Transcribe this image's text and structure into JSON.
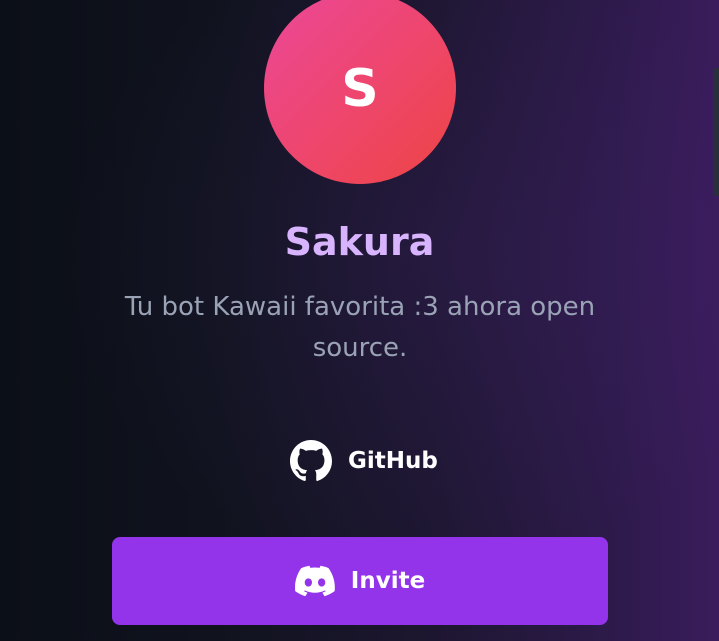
{
  "profile": {
    "avatar_letter": "S",
    "name": "Sakura",
    "tagline": "Tu bot Kawaii favorita :3 ahora open source."
  },
  "links": {
    "github_label": "GitHub",
    "github_icon": "github-icon",
    "invite_label": "Invite",
    "invite_icon": "discord-icon"
  },
  "colors": {
    "name": "#d8b4fe",
    "avatar_gradient_start": "#ec4899",
    "avatar_gradient_end": "#ef4444",
    "invite_button": "#9333ea",
    "tagline": "#9aa3b5"
  }
}
